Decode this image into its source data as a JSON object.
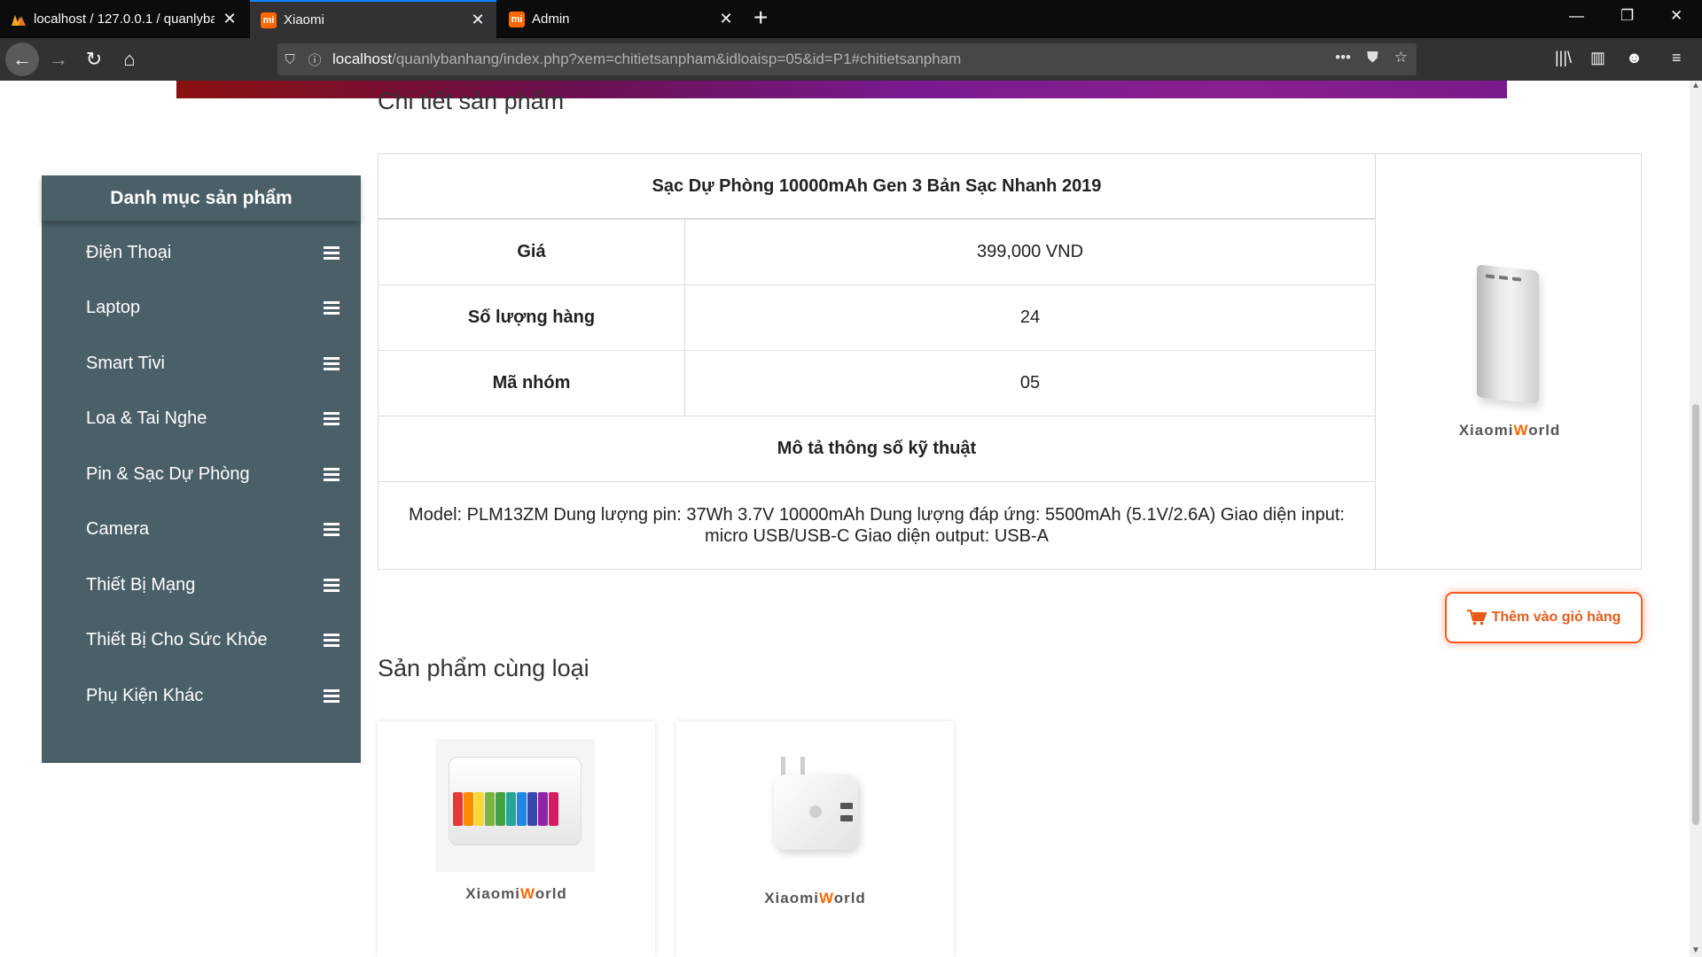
{
  "browser": {
    "tabs": [
      {
        "label": "localhost / 127.0.0.1 / quanlyba",
        "icon": "phpmyadmin-icon"
      },
      {
        "label": "Xiaomi",
        "icon": "xiaomi-icon"
      },
      {
        "label": "Admin",
        "icon": "xiaomi-icon"
      }
    ],
    "url_host": "localhost",
    "url_path": "/quanlybanhang/index.php?xem=chitietsanpham&idloaisp=05&id=P1#chitietsanpham"
  },
  "sidebar": {
    "title": "Danh mục sản phẩm",
    "items": [
      {
        "label": "Điện Thoại"
      },
      {
        "label": "Laptop"
      },
      {
        "label": "Smart Tivi"
      },
      {
        "label": "Loa & Tai Nghe"
      },
      {
        "label": "Pin & Sạc Dự Phòng"
      },
      {
        "label": "Camera"
      },
      {
        "label": "Thiết Bị Mạng"
      },
      {
        "label": "Thiết Bị Cho Sức Khỏe"
      },
      {
        "label": "Phụ Kiện Khác"
      }
    ]
  },
  "detail": {
    "section_title": "Chi tiết sản phẩm",
    "product_name": "Sạc Dự Phòng 10000mAh Gen 3 Bản Sạc Nhanh 2019",
    "price_label": "Giá",
    "price_value": "399,000 VND",
    "qty_label": "Số lượng hàng",
    "qty_value": "24",
    "group_label": "Mã nhóm",
    "group_value": "05",
    "spec_title": "Mô tả thông số kỹ thuật",
    "spec_text_line1": "Model: PLM13ZM Dung lượng pin: 37Wh 3.7V 10000mAh Dung lượng đáp ứng: 5500mAh (5.1V/2.6A) Giao diện input:",
    "spec_text_line2": "micro USB/USB-C Giao diện output: USB-A",
    "image_brand_prefix": "Xiaomi",
    "image_brand_w": "W",
    "image_brand_suffix": "orld"
  },
  "cart_button": {
    "label": "Thêm vào giỏ hàng"
  },
  "related": {
    "section_title": "Sản phẩm cùng loại",
    "cards": [
      {
        "brand_prefix": "Xiaomi",
        "brand_w": "W",
        "brand_suffix": "orld"
      },
      {
        "brand_prefix": "Xiaomi",
        "brand_w": "W",
        "brand_suffix": "orld"
      }
    ]
  },
  "colors": {
    "sidebar_bg": "#4a5f68",
    "accent": "#ff5722",
    "brand_orange": "#ff6700"
  }
}
